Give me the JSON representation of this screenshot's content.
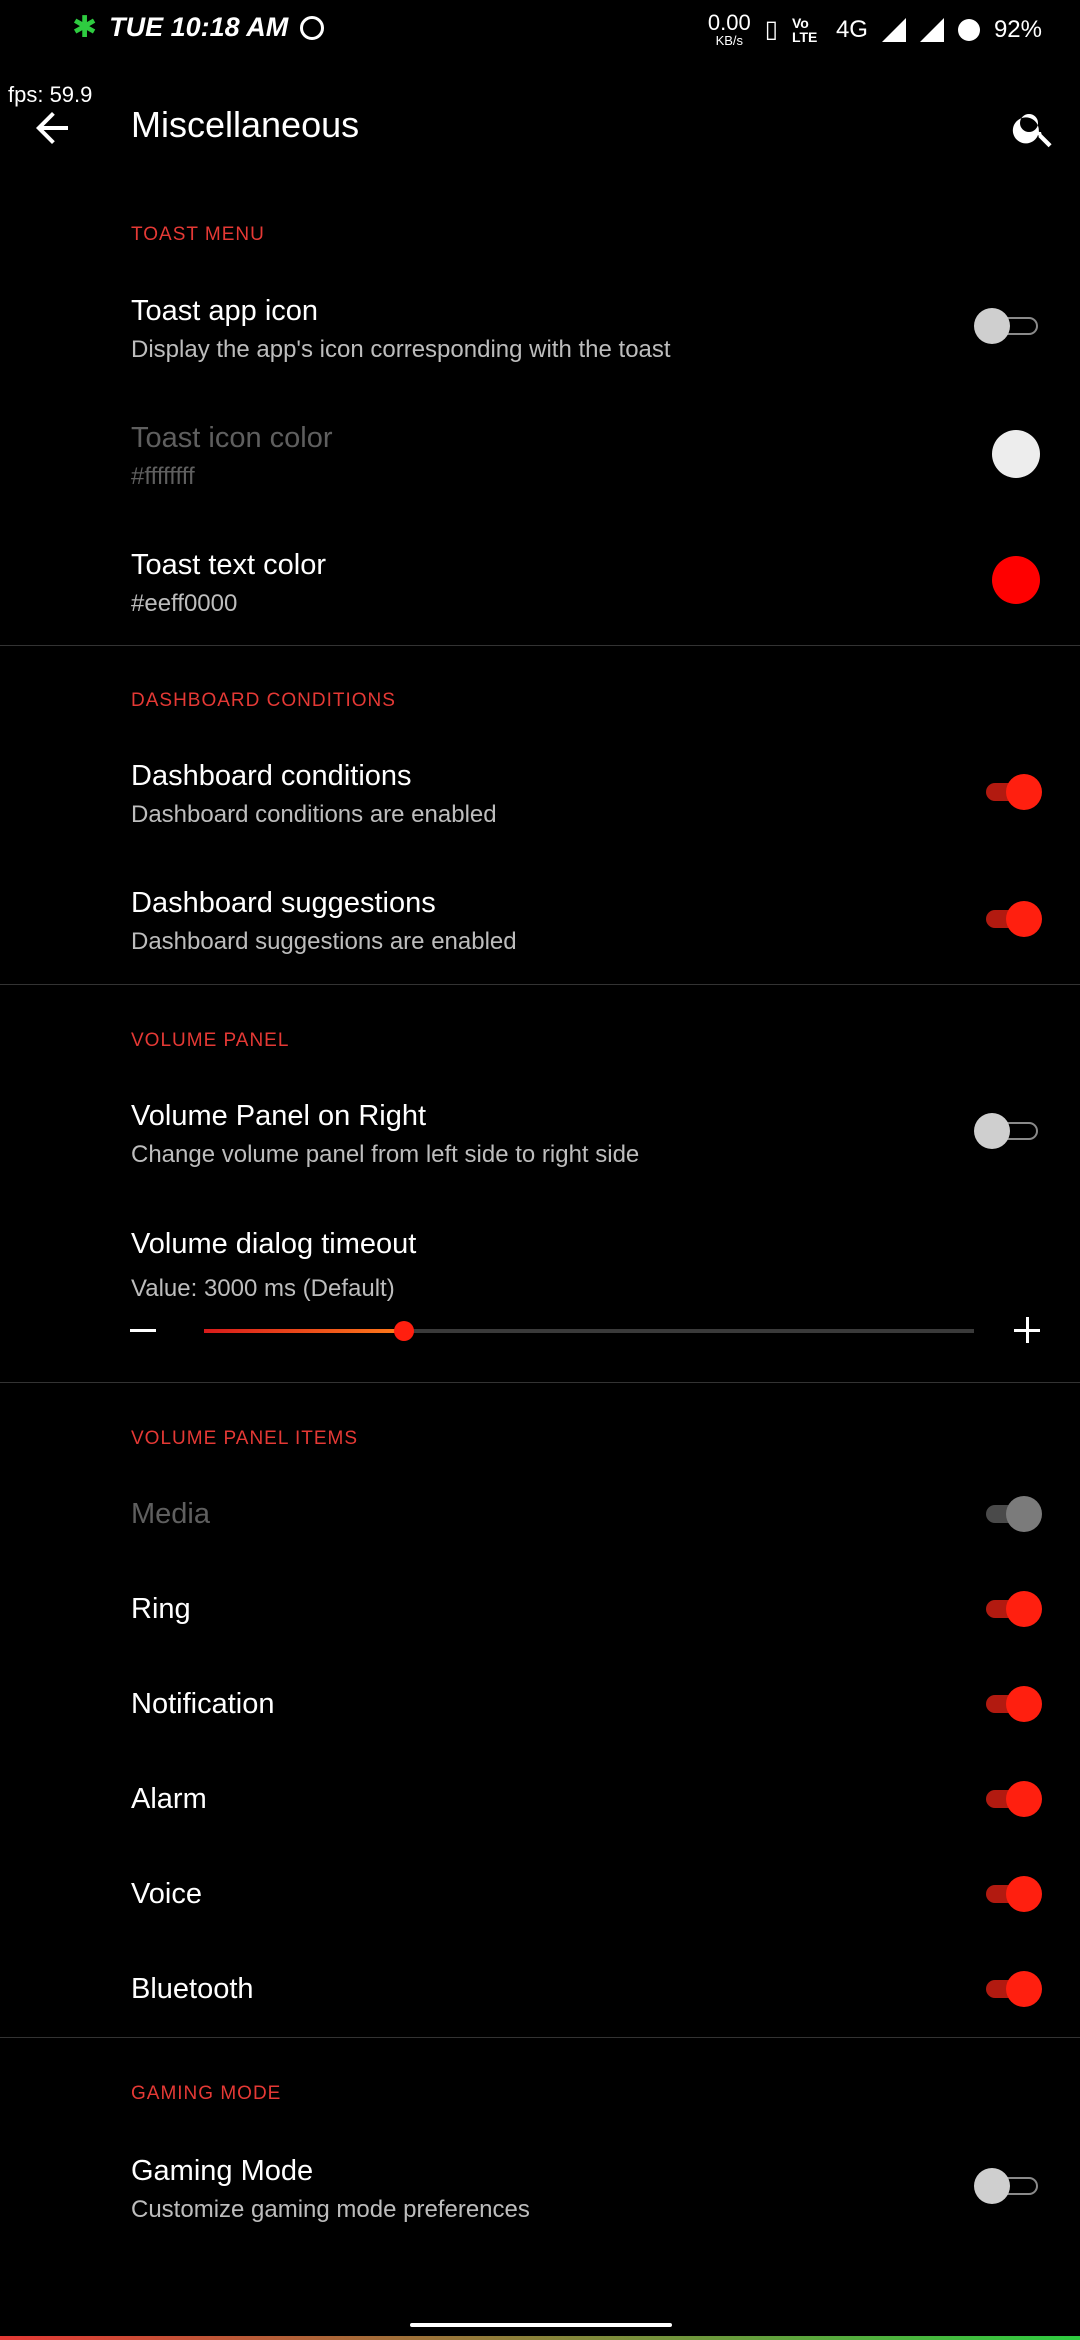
{
  "status": {
    "time": "TUE 10:18 AM",
    "speed_value": "0.00",
    "speed_unit": "KB/s",
    "volte": "Vo LTE",
    "network": "4G",
    "battery": "92%"
  },
  "fps": "fps: 59.9",
  "appbar": {
    "title": "Miscellaneous"
  },
  "sections": {
    "toast": {
      "header": "TOAST MENU",
      "app_icon": {
        "title": "Toast app icon",
        "summary": "Display the app's icon corresponding with the toast",
        "enabled": false
      },
      "icon_color": {
        "title": "Toast icon color",
        "summary": "#ffffffff",
        "color": "#ededed"
      },
      "text_color": {
        "title": "Toast text color",
        "summary": "#eeff0000",
        "color": "#ff0000"
      }
    },
    "dashboard": {
      "header": "DASHBOARD CONDITIONS",
      "conditions": {
        "title": "Dashboard conditions",
        "summary": "Dashboard conditions are enabled",
        "enabled": true
      },
      "suggestions": {
        "title": "Dashboard suggestions",
        "summary": "Dashboard suggestions are enabled",
        "enabled": true
      }
    },
    "volume": {
      "header": "VOLUME PANEL",
      "right": {
        "title": "Volume Panel on Right",
        "summary": "Change volume panel from left side to right side",
        "enabled": false
      },
      "timeout": {
        "title": "Volume dialog timeout",
        "summary": "Value: 3000 ms (Default)",
        "slider_fraction": 0.26
      }
    },
    "volume_items": {
      "header": "VOLUME PANEL ITEMS",
      "items": [
        {
          "label": "Media",
          "enabled": true,
          "disabled": true
        },
        {
          "label": "Ring",
          "enabled": true
        },
        {
          "label": "Notification",
          "enabled": true
        },
        {
          "label": "Alarm",
          "enabled": true
        },
        {
          "label": "Voice",
          "enabled": true
        },
        {
          "label": "Bluetooth",
          "enabled": true
        }
      ]
    },
    "gaming": {
      "header": "GAMING MODE",
      "mode": {
        "title": "Gaming Mode",
        "summary": "Customize gaming mode preferences",
        "enabled": false
      }
    }
  },
  "colors": {
    "accent": "#e53935",
    "switch_on": "#ff1f0f",
    "background": "#000000"
  }
}
